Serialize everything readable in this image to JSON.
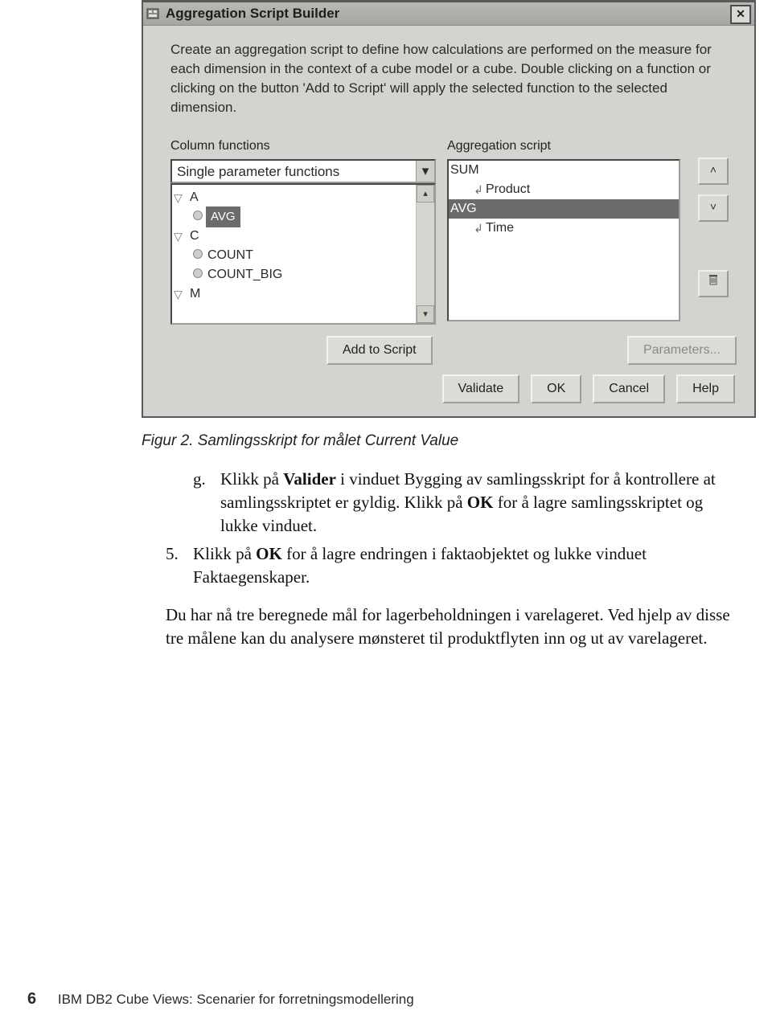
{
  "dialog": {
    "title": "Aggregation Script Builder",
    "intro": "Create an aggregation script to define how calculations are performed on the measure for each dimension in the context of a cube model or a cube. Double clicking on a function or clicking on the button 'Add to Script' will apply the selected function to the selected dimension.",
    "left": {
      "label": "Column functions",
      "combo": "Single parameter functions",
      "items": {
        "a": "A",
        "avg": "AVG",
        "c": "C",
        "count": "COUNT",
        "count_big": "COUNT_BIG",
        "m": "M"
      }
    },
    "right": {
      "label": "Aggregation script",
      "items": {
        "sum": "SUM",
        "product": "Product",
        "avg": "AVG",
        "time": "Time"
      }
    },
    "buttons": {
      "add": "Add to Script",
      "params": "Parameters...",
      "validate": "Validate",
      "ok": "OK",
      "cancel": "Cancel",
      "help": "Help"
    }
  },
  "caption": "Figur 2. Samlingsskript for målet Current Value",
  "steps": {
    "g": {
      "marker": "g.",
      "text_pre": "Klikk på ",
      "bold1": "Valider",
      "text_mid1": " i vinduet Bygging av samlingsskript for å kontrollere at samlingsskriptet er gyldig. Klikk på ",
      "bold2": "OK",
      "text_mid2": " for å lagre samlingsskriptet og lukke vinduet."
    },
    "five": {
      "marker": "5.",
      "text_pre": "Klikk på ",
      "bold1": "OK",
      "text_post": " for å lagre endringen i faktaobjektet og lukke vinduet Faktaegenskaper."
    }
  },
  "paragraph": "Du har nå tre beregnede mål for lagerbeholdningen i varelageret. Ved hjelp av disse tre målene kan du analysere mønsteret til produktflyten inn og ut av varelageret.",
  "footer": {
    "page": "6",
    "book": "IBM DB2 Cube Views: Scenarier for forretningsmodellering"
  }
}
